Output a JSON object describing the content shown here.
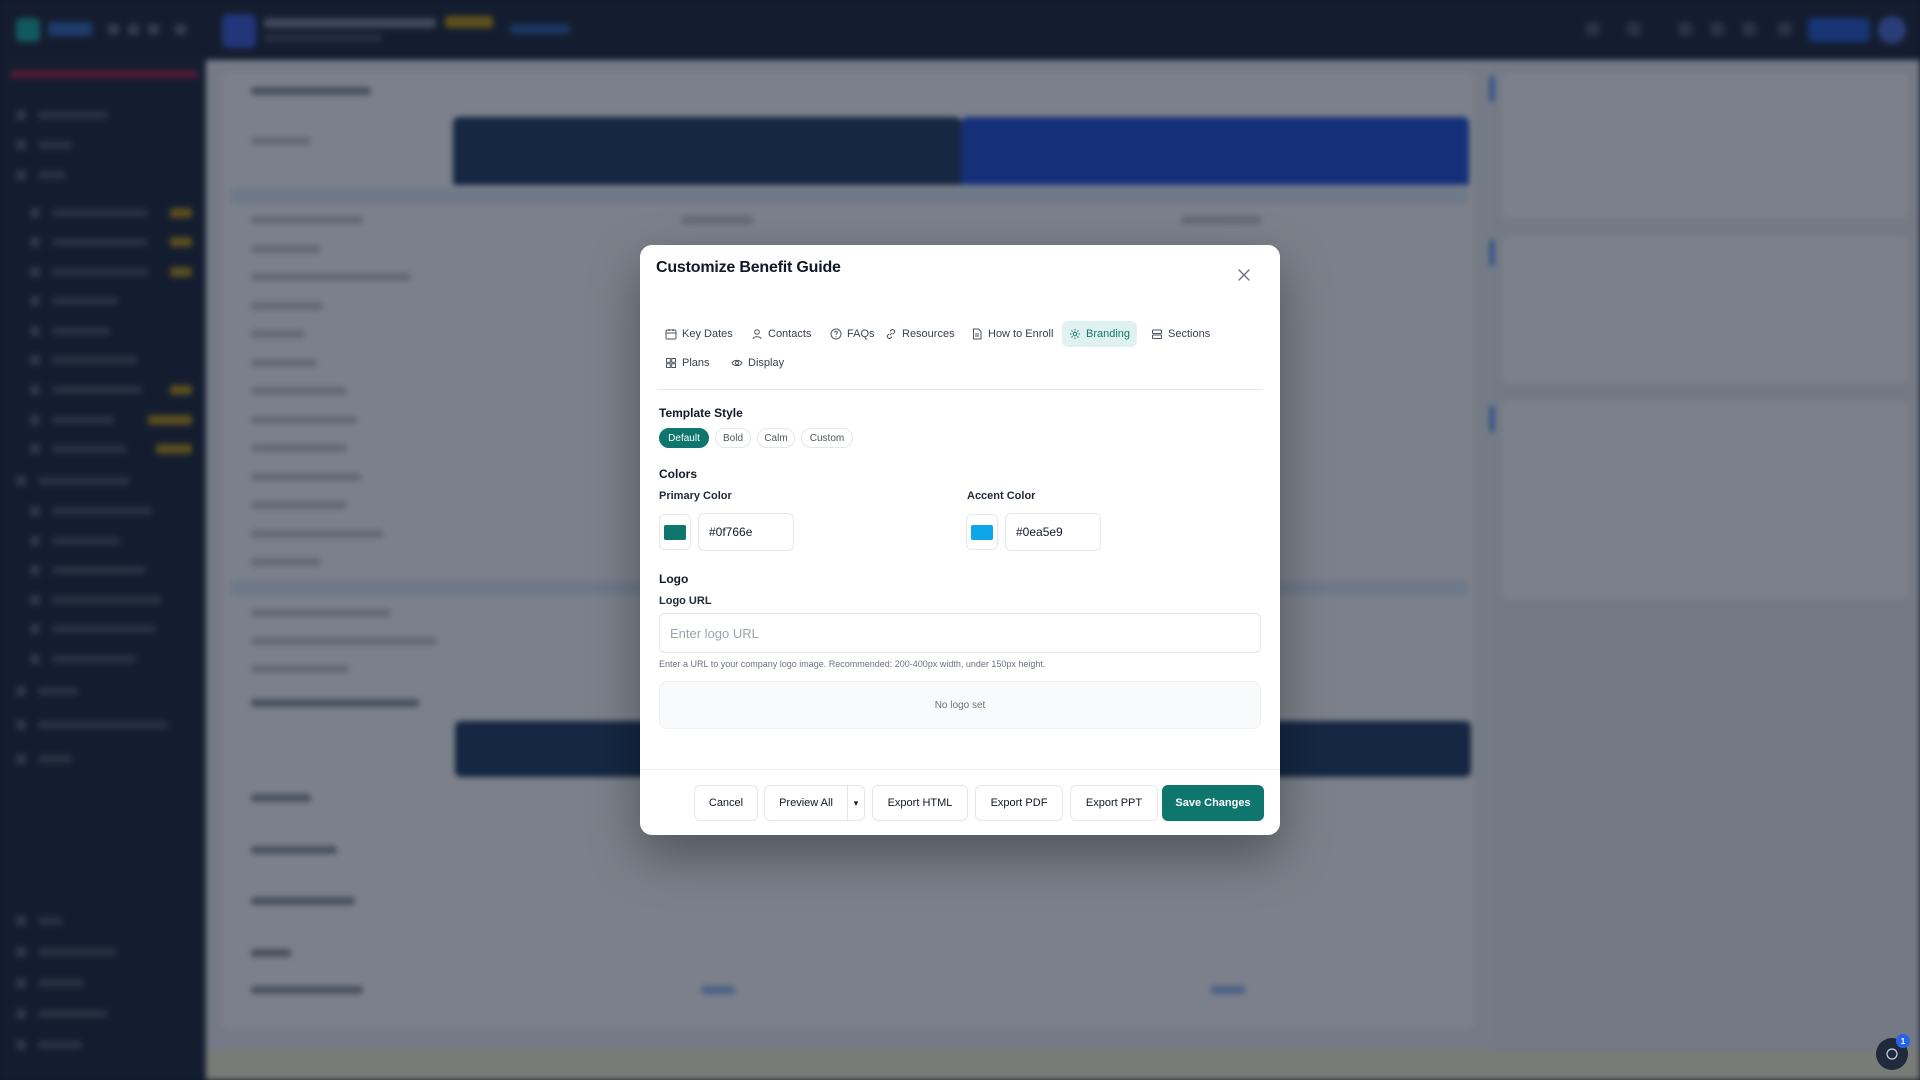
{
  "modal": {
    "title": "Customize Benefit Guide",
    "tabs": [
      {
        "label": "Key Dates",
        "icon": "calendar-icon"
      },
      {
        "label": "Contacts",
        "icon": "person-icon"
      },
      {
        "label": "FAQs",
        "icon": "help-circle-icon"
      },
      {
        "label": "Resources",
        "icon": "link-icon"
      },
      {
        "label": "How to Enroll",
        "icon": "document-icon"
      },
      {
        "label": "Branding",
        "icon": "gear-icon",
        "active": true
      },
      {
        "label": "Sections",
        "icon": "layers-icon"
      },
      {
        "label": "Plans",
        "icon": "grid-icon"
      },
      {
        "label": "Display",
        "icon": "eye-icon"
      }
    ],
    "template_style": {
      "label": "Template Style",
      "options": [
        "Default",
        "Bold",
        "Calm",
        "Custom"
      ],
      "selected": "Default"
    },
    "colors": {
      "label": "Colors",
      "primary": {
        "label": "Primary Color",
        "value": "#0f766e"
      },
      "accent": {
        "label": "Accent Color",
        "value": "#0ea5e9"
      }
    },
    "logo": {
      "label": "Logo",
      "url_label": "Logo URL",
      "placeholder": "Enter logo URL",
      "value": "",
      "hint": "Enter a URL to your company logo image. Recommended: 200-400px width, under 150px height.",
      "empty_text": "No logo set"
    },
    "footer": {
      "cancel": "Cancel",
      "preview_all": "Preview All",
      "preview_menu": "▾",
      "export_html": "Export HTML",
      "export_pdf": "Export PDF",
      "export_ppt": "Export PPT",
      "save": "Save Changes"
    }
  },
  "help_badge_count": "1",
  "theme": {
    "brand": "#0f766e",
    "accent": "#0ea5e9",
    "overlay": "rgba(15,23,42,0.55)"
  }
}
